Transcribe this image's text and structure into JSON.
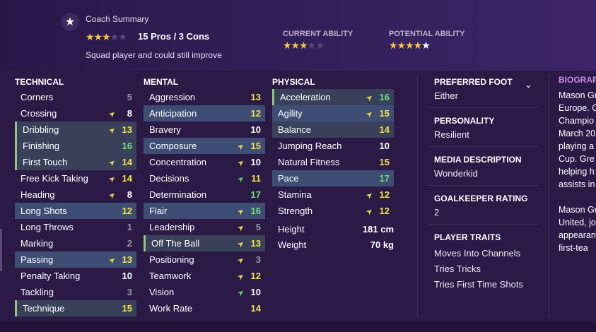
{
  "coach": {
    "title": "Coach Summary",
    "stars": "★★★★★",
    "stars_filled": 3,
    "summary": "15 Pros / 3 Cons",
    "description": "Squad player and could still improve"
  },
  "ability": {
    "current_label": "CURRENT ABILITY",
    "current_stars": "★★★★★",
    "current_filled": 3,
    "potential_label": "POTENTIAL ABILITY",
    "potential_stars": "★★★★★",
    "potential_filled": 4.5
  },
  "headers": {
    "technical": "TECHNICAL",
    "mental": "MENTAL",
    "physical": "PHYSICAL"
  },
  "technical": [
    {
      "name": "Corners",
      "value": "5",
      "arrow": ""
    },
    {
      "name": "Crossing",
      "value": "8",
      "arrow": "up"
    },
    {
      "name": "Dribbling",
      "value": "13",
      "arrow": "up"
    },
    {
      "name": "Finishing",
      "value": "16",
      "arrow": ""
    },
    {
      "name": "First Touch",
      "value": "14",
      "arrow": "up"
    },
    {
      "name": "Free Kick Taking",
      "value": "14",
      "arrow": "up"
    },
    {
      "name": "Heading",
      "value": "8",
      "arrow": "up"
    },
    {
      "name": "Long Shots",
      "value": "12",
      "arrow": ""
    },
    {
      "name": "Long Throws",
      "value": "1",
      "arrow": ""
    },
    {
      "name": "Marking",
      "value": "2",
      "arrow": ""
    },
    {
      "name": "Passing",
      "value": "13",
      "arrow": "up"
    },
    {
      "name": "Penalty Taking",
      "value": "10",
      "arrow": ""
    },
    {
      "name": "Tackling",
      "value": "3",
      "arrow": ""
    },
    {
      "name": "Technique",
      "value": "15",
      "arrow": ""
    }
  ],
  "mental": [
    {
      "name": "Aggression",
      "value": "13",
      "arrow": ""
    },
    {
      "name": "Anticipation",
      "value": "12",
      "arrow": ""
    },
    {
      "name": "Bravery",
      "value": "10",
      "arrow": ""
    },
    {
      "name": "Composure",
      "value": "15",
      "arrow": "up"
    },
    {
      "name": "Concentration",
      "value": "10",
      "arrow": "up"
    },
    {
      "name": "Decisions",
      "value": "11",
      "arrow": "up-green"
    },
    {
      "name": "Determination",
      "value": "17",
      "arrow": ""
    },
    {
      "name": "Flair",
      "value": "16",
      "arrow": "up"
    },
    {
      "name": "Leadership",
      "value": "5",
      "arrow": "up"
    },
    {
      "name": "Off The Ball",
      "value": "13",
      "arrow": "up"
    },
    {
      "name": "Positioning",
      "value": "3",
      "arrow": "up"
    },
    {
      "name": "Teamwork",
      "value": "12",
      "arrow": "up"
    },
    {
      "name": "Vision",
      "value": "10",
      "arrow": "up-green"
    },
    {
      "name": "Work Rate",
      "value": "14",
      "arrow": ""
    }
  ],
  "physical": [
    {
      "name": "Acceleration",
      "value": "16",
      "arrow": "up"
    },
    {
      "name": "Agility",
      "value": "15",
      "arrow": "up"
    },
    {
      "name": "Balance",
      "value": "14",
      "arrow": ""
    },
    {
      "name": "Jumping Reach",
      "value": "10",
      "arrow": ""
    },
    {
      "name": "Natural Fitness",
      "value": "15",
      "arrow": ""
    },
    {
      "name": "Pace",
      "value": "17",
      "arrow": ""
    },
    {
      "name": "Stamina",
      "value": "12",
      "arrow": "up"
    },
    {
      "name": "Strength",
      "value": "12",
      "arrow": "up"
    }
  ],
  "physical_extra": {
    "height_label": "Height",
    "height_value": "181 cm",
    "weight_label": "Weight",
    "weight_value": "70 kg"
  },
  "info": {
    "foot_label": "PREFERRED FOOT",
    "foot_value": "Either",
    "personality_label": "PERSONALITY",
    "personality_value": "Resilient",
    "media_label": "MEDIA DESCRIPTION",
    "media_value": "Wonderkid",
    "gk_label": "GOALKEEPER RATING",
    "gk_value": "2",
    "traits_label": "PLAYER TRAITS",
    "traits": [
      "Moves Into Channels",
      "Tries Tricks",
      "Tries First Time Shots"
    ]
  },
  "bio": {
    "heading": "BIOGRAP",
    "lines": [
      "Mason Gr",
      "Europe. C",
      "Champio",
      "March 20",
      "playing a",
      "Cup. Gre",
      "helping h",
      "assists in",
      "",
      "Mason Gr",
      "United, jo",
      "appearan",
      "first-tea"
    ]
  },
  "colors": {
    "value_white": "#ffffff",
    "value_yellow": "#f2e24a",
    "value_green": "#6ee07a",
    "value_grey": "#9a93a8",
    "arrow_yellow": "#e8d84a",
    "arrow_green": "#5ed36a"
  }
}
